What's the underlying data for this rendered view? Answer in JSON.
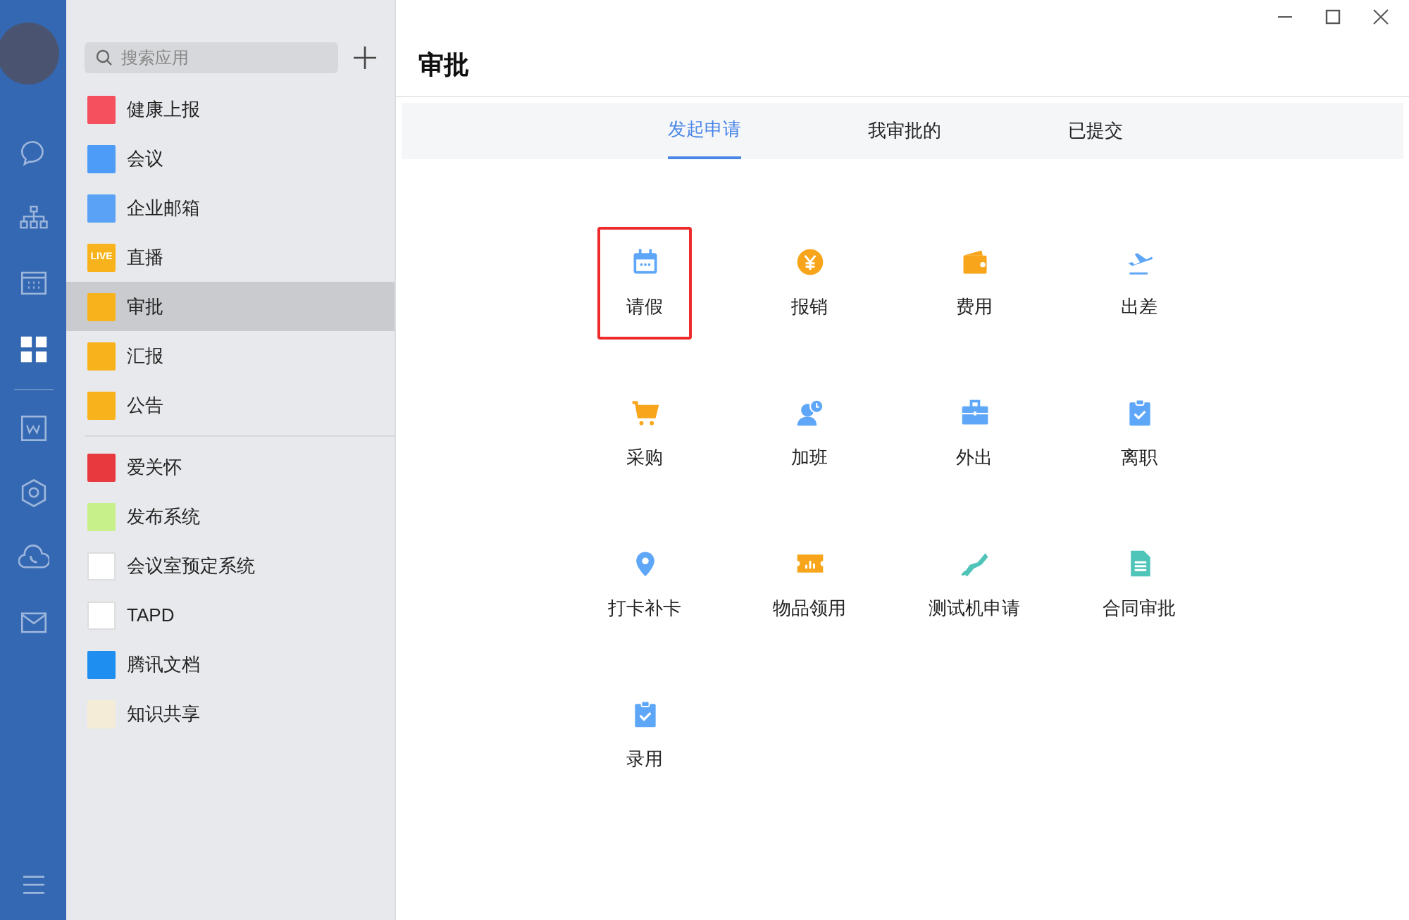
{
  "rail": {
    "items": [
      {
        "kind": "chat",
        "selected": false
      },
      {
        "kind": "org",
        "selected": false
      },
      {
        "kind": "calendar",
        "selected": false
      },
      {
        "kind": "apps",
        "selected": true
      },
      {
        "kind": "doc",
        "selected": false
      },
      {
        "kind": "cube",
        "selected": false
      },
      {
        "kind": "phone",
        "selected": false
      },
      {
        "kind": "mail",
        "selected": false
      }
    ]
  },
  "sidebar": {
    "search": {
      "placeholder": "搜索应用"
    },
    "groups": [
      [
        {
          "label": "健康上报",
          "color": "#f4505e",
          "selected": false
        },
        {
          "label": "会议",
          "color": "#4d9cf8",
          "selected": false
        },
        {
          "label": "企业邮箱",
          "color": "#5aa2f6",
          "selected": false
        },
        {
          "label": "直播",
          "color": "#f8b31c",
          "badge": "LIVE",
          "selected": false
        },
        {
          "label": "审批",
          "color": "#f8b31c",
          "selected": true
        },
        {
          "label": "汇报",
          "color": "#f8b31c",
          "selected": false
        },
        {
          "label": "公告",
          "color": "#f8b31c",
          "selected": false
        }
      ],
      [
        {
          "label": "爱关怀",
          "color": "#e8393e",
          "selected": false
        },
        {
          "label": "发布系统",
          "color": "#c8f08a",
          "selected": false
        },
        {
          "label": "会议室预定系统",
          "color": "#ffffff",
          "selected": false
        },
        {
          "label": "TAPD",
          "color": "#ffffff",
          "selected": false
        },
        {
          "label": "腾讯文档",
          "color": "#1e8ef0",
          "selected": false
        },
        {
          "label": "知识共享",
          "color": "#f5ecd8",
          "selected": false
        }
      ]
    ]
  },
  "main": {
    "title": "审批",
    "tabs": [
      {
        "label": "发起申请",
        "selected": true
      },
      {
        "label": "我审批的",
        "selected": false
      },
      {
        "label": "已提交",
        "selected": false
      }
    ],
    "apps": [
      {
        "label": "请假",
        "color": "#5ea6f7",
        "highlighted": true
      },
      {
        "label": "报销",
        "color": "#f8a51c",
        "highlighted": false
      },
      {
        "label": "费用",
        "color": "#f8a51c",
        "highlighted": false
      },
      {
        "label": "出差",
        "color": "#5ea6f7",
        "highlighted": false
      },
      {
        "label": "采购",
        "color": "#f8a51c",
        "highlighted": false
      },
      {
        "label": "加班",
        "color": "#5ea6f7",
        "highlighted": false
      },
      {
        "label": "外出",
        "color": "#5ea6f7",
        "highlighted": false
      },
      {
        "label": "离职",
        "color": "#5ea6f7",
        "highlighted": false
      },
      {
        "label": "打卡补卡",
        "color": "#5ea6f7",
        "highlighted": false
      },
      {
        "label": "物品领用",
        "color": "#f8a51c",
        "highlighted": false
      },
      {
        "label": "测试机申请",
        "color": "#4fc4b8",
        "highlighted": false
      },
      {
        "label": "合同审批",
        "color": "#4fc4b8",
        "highlighted": false
      },
      {
        "label": "录用",
        "color": "#5ea6f7",
        "highlighted": false
      }
    ]
  }
}
